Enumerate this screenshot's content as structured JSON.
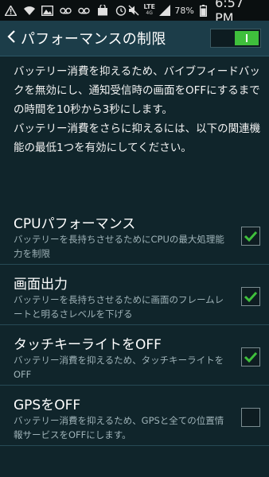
{
  "status_bar": {
    "icons": [
      "warning-icon",
      "wifi-icon",
      "image-icon",
      "recorder-icon",
      "recorder-icon",
      "bag-icon",
      "alarm-icon"
    ],
    "right_icons": [
      "mute-icon",
      "signal-icon",
      "battery-icon"
    ],
    "network": "LTE",
    "network_sub": "4G",
    "battery_percent": "78%",
    "time": "6:57 PM"
  },
  "header": {
    "title": "パフォーマンスの制限",
    "master_switch_on": true
  },
  "description": {
    "para1": "バッテリー消費を抑えるため、バイブフィードバックを無効にし、通知受信時の画面をOFFにするまでの時間を10秒から3秒にします。",
    "para2": "バッテリー消費をさらに抑えるには、以下の関連機能の最低1つを有効にしてください。"
  },
  "options": [
    {
      "title": "CPUパフォーマンス",
      "summary": "バッテリーを長持ちさせるためにCPUの最大処理能力を制限",
      "checked": true
    },
    {
      "title": "画面出力",
      "summary": "バッテリーを長持ちさせるために画面のフレームレートと明るさレベルを下げる",
      "checked": true
    },
    {
      "title": "タッチキーライトをOFF",
      "summary": "バッテリー消費を抑えるため、タッチキーライトをOFF",
      "checked": true
    },
    {
      "title": "GPSをOFF",
      "summary": "バッテリー消費を抑えるため、GPSと全ての位置情報サービスをOFFにします。",
      "checked": false
    }
  ],
  "colors": {
    "background": "#10252b",
    "action_bar": "#1c3d49",
    "accent_green": "#3fbf3c",
    "summary_text": "#9fb3b8"
  }
}
